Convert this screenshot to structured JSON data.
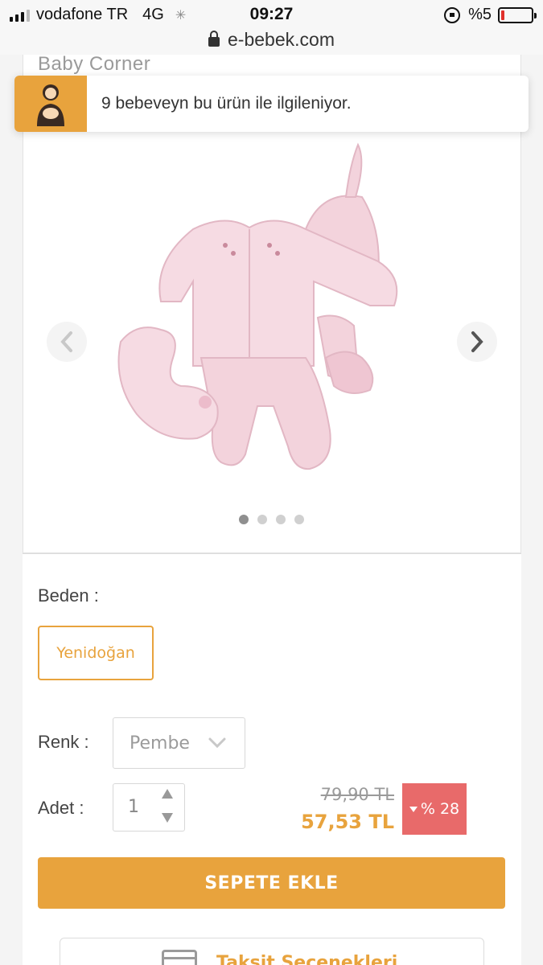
{
  "status_bar": {
    "carrier": "vodafone TR",
    "network": "4G",
    "time": "09:27",
    "battery": "%5"
  },
  "url_bar": {
    "domain": "e-bebek.com"
  },
  "product": {
    "brand": "Baby Corner",
    "image_icon": "baby-clothing-set-image",
    "carousel_total": 4,
    "carousel_active": 1
  },
  "notification": {
    "count": "9",
    "text": "bebeveyn bu ürün ile ilgileniyor.",
    "icon": "mother-baby-icon"
  },
  "options": {
    "size_label": "Beden :",
    "size_value": "Yenidoğan",
    "color_label": "Renk :",
    "color_value": "Pembe",
    "quantity_label": "Adet :",
    "quantity_value": "1"
  },
  "pricing": {
    "old_price": "79,90 TL",
    "new_price": "57,53 TL",
    "discount": "% 28"
  },
  "actions": {
    "add_to_cart": "SEPETE EKLE",
    "installments": "Taksit Seçenekleri"
  },
  "colors": {
    "accent": "#e8a33d",
    "discount_bg": "#e86a6a",
    "product_pink": "#f3d3dc"
  }
}
